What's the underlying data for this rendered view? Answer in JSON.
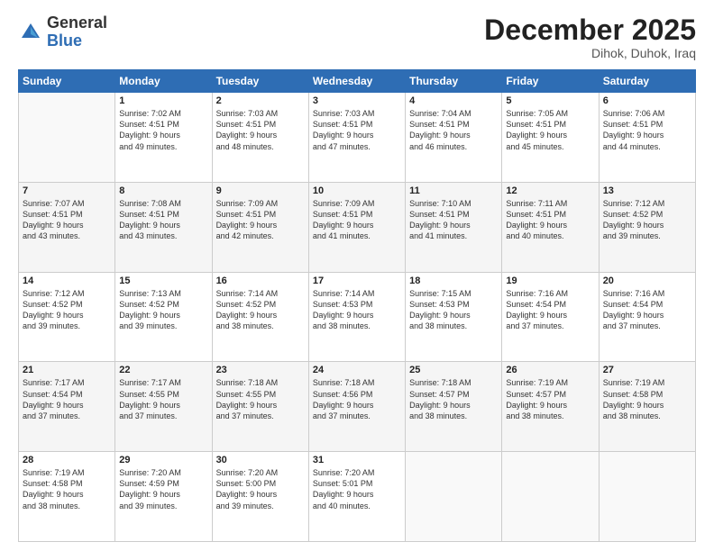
{
  "header": {
    "logo_general": "General",
    "logo_blue": "Blue",
    "month_title": "December 2025",
    "location": "Dihok, Duhok, Iraq"
  },
  "days_of_week": [
    "Sunday",
    "Monday",
    "Tuesday",
    "Wednesday",
    "Thursday",
    "Friday",
    "Saturday"
  ],
  "weeks": [
    [
      {
        "day": "",
        "info": ""
      },
      {
        "day": "1",
        "info": "Sunrise: 7:02 AM\nSunset: 4:51 PM\nDaylight: 9 hours\nand 49 minutes."
      },
      {
        "day": "2",
        "info": "Sunrise: 7:03 AM\nSunset: 4:51 PM\nDaylight: 9 hours\nand 48 minutes."
      },
      {
        "day": "3",
        "info": "Sunrise: 7:03 AM\nSunset: 4:51 PM\nDaylight: 9 hours\nand 47 minutes."
      },
      {
        "day": "4",
        "info": "Sunrise: 7:04 AM\nSunset: 4:51 PM\nDaylight: 9 hours\nand 46 minutes."
      },
      {
        "day": "5",
        "info": "Sunrise: 7:05 AM\nSunset: 4:51 PM\nDaylight: 9 hours\nand 45 minutes."
      },
      {
        "day": "6",
        "info": "Sunrise: 7:06 AM\nSunset: 4:51 PM\nDaylight: 9 hours\nand 44 minutes."
      }
    ],
    [
      {
        "day": "7",
        "info": "Sunrise: 7:07 AM\nSunset: 4:51 PM\nDaylight: 9 hours\nand 43 minutes."
      },
      {
        "day": "8",
        "info": "Sunrise: 7:08 AM\nSunset: 4:51 PM\nDaylight: 9 hours\nand 43 minutes."
      },
      {
        "day": "9",
        "info": "Sunrise: 7:09 AM\nSunset: 4:51 PM\nDaylight: 9 hours\nand 42 minutes."
      },
      {
        "day": "10",
        "info": "Sunrise: 7:09 AM\nSunset: 4:51 PM\nDaylight: 9 hours\nand 41 minutes."
      },
      {
        "day": "11",
        "info": "Sunrise: 7:10 AM\nSunset: 4:51 PM\nDaylight: 9 hours\nand 41 minutes."
      },
      {
        "day": "12",
        "info": "Sunrise: 7:11 AM\nSunset: 4:51 PM\nDaylight: 9 hours\nand 40 minutes."
      },
      {
        "day": "13",
        "info": "Sunrise: 7:12 AM\nSunset: 4:52 PM\nDaylight: 9 hours\nand 39 minutes."
      }
    ],
    [
      {
        "day": "14",
        "info": "Sunrise: 7:12 AM\nSunset: 4:52 PM\nDaylight: 9 hours\nand 39 minutes."
      },
      {
        "day": "15",
        "info": "Sunrise: 7:13 AM\nSunset: 4:52 PM\nDaylight: 9 hours\nand 39 minutes."
      },
      {
        "day": "16",
        "info": "Sunrise: 7:14 AM\nSunset: 4:52 PM\nDaylight: 9 hours\nand 38 minutes."
      },
      {
        "day": "17",
        "info": "Sunrise: 7:14 AM\nSunset: 4:53 PM\nDaylight: 9 hours\nand 38 minutes."
      },
      {
        "day": "18",
        "info": "Sunrise: 7:15 AM\nSunset: 4:53 PM\nDaylight: 9 hours\nand 38 minutes."
      },
      {
        "day": "19",
        "info": "Sunrise: 7:16 AM\nSunset: 4:54 PM\nDaylight: 9 hours\nand 37 minutes."
      },
      {
        "day": "20",
        "info": "Sunrise: 7:16 AM\nSunset: 4:54 PM\nDaylight: 9 hours\nand 37 minutes."
      }
    ],
    [
      {
        "day": "21",
        "info": "Sunrise: 7:17 AM\nSunset: 4:54 PM\nDaylight: 9 hours\nand 37 minutes."
      },
      {
        "day": "22",
        "info": "Sunrise: 7:17 AM\nSunset: 4:55 PM\nDaylight: 9 hours\nand 37 minutes."
      },
      {
        "day": "23",
        "info": "Sunrise: 7:18 AM\nSunset: 4:55 PM\nDaylight: 9 hours\nand 37 minutes."
      },
      {
        "day": "24",
        "info": "Sunrise: 7:18 AM\nSunset: 4:56 PM\nDaylight: 9 hours\nand 37 minutes."
      },
      {
        "day": "25",
        "info": "Sunrise: 7:18 AM\nSunset: 4:57 PM\nDaylight: 9 hours\nand 38 minutes."
      },
      {
        "day": "26",
        "info": "Sunrise: 7:19 AM\nSunset: 4:57 PM\nDaylight: 9 hours\nand 38 minutes."
      },
      {
        "day": "27",
        "info": "Sunrise: 7:19 AM\nSunset: 4:58 PM\nDaylight: 9 hours\nand 38 minutes."
      }
    ],
    [
      {
        "day": "28",
        "info": "Sunrise: 7:19 AM\nSunset: 4:58 PM\nDaylight: 9 hours\nand 38 minutes."
      },
      {
        "day": "29",
        "info": "Sunrise: 7:20 AM\nSunset: 4:59 PM\nDaylight: 9 hours\nand 39 minutes."
      },
      {
        "day": "30",
        "info": "Sunrise: 7:20 AM\nSunset: 5:00 PM\nDaylight: 9 hours\nand 39 minutes."
      },
      {
        "day": "31",
        "info": "Sunrise: 7:20 AM\nSunset: 5:01 PM\nDaylight: 9 hours\nand 40 minutes."
      },
      {
        "day": "",
        "info": ""
      },
      {
        "day": "",
        "info": ""
      },
      {
        "day": "",
        "info": ""
      }
    ]
  ]
}
